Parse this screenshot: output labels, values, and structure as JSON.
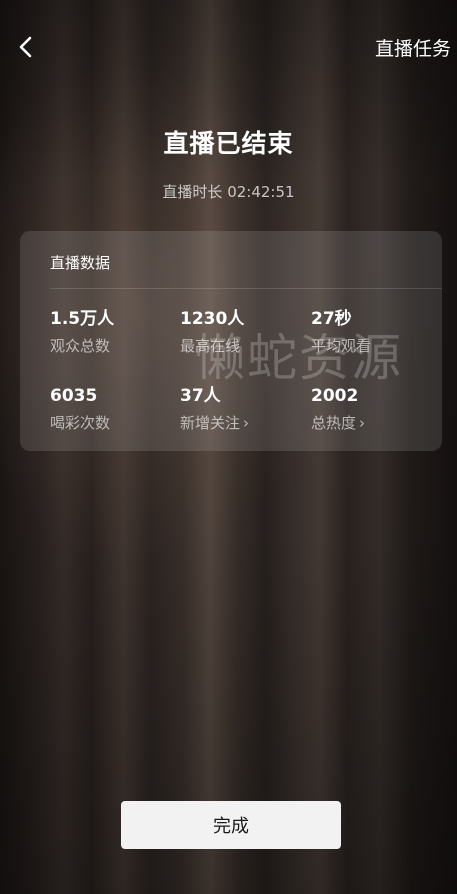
{
  "header": {
    "back_icon": "chevron-left-icon",
    "task_link": "直播任务"
  },
  "main": {
    "title": "直播已结束",
    "duration": "直播时长 02:42:51"
  },
  "card": {
    "title": "直播数据",
    "stats": [
      {
        "value": "1.5万人",
        "label": "观众总数"
      },
      {
        "value": "1230人",
        "label": "最高在线"
      },
      {
        "value": "27秒",
        "label": "平均观看"
      },
      {
        "value": "6035",
        "label": "喝彩次数"
      },
      {
        "value": "37人",
        "label": "新增关注"
      },
      {
        "value": "2002",
        "label": "总热度"
      }
    ],
    "chevron": "›"
  },
  "watermark": "懒蛇资源",
  "footer": {
    "done_label": "完成"
  }
}
